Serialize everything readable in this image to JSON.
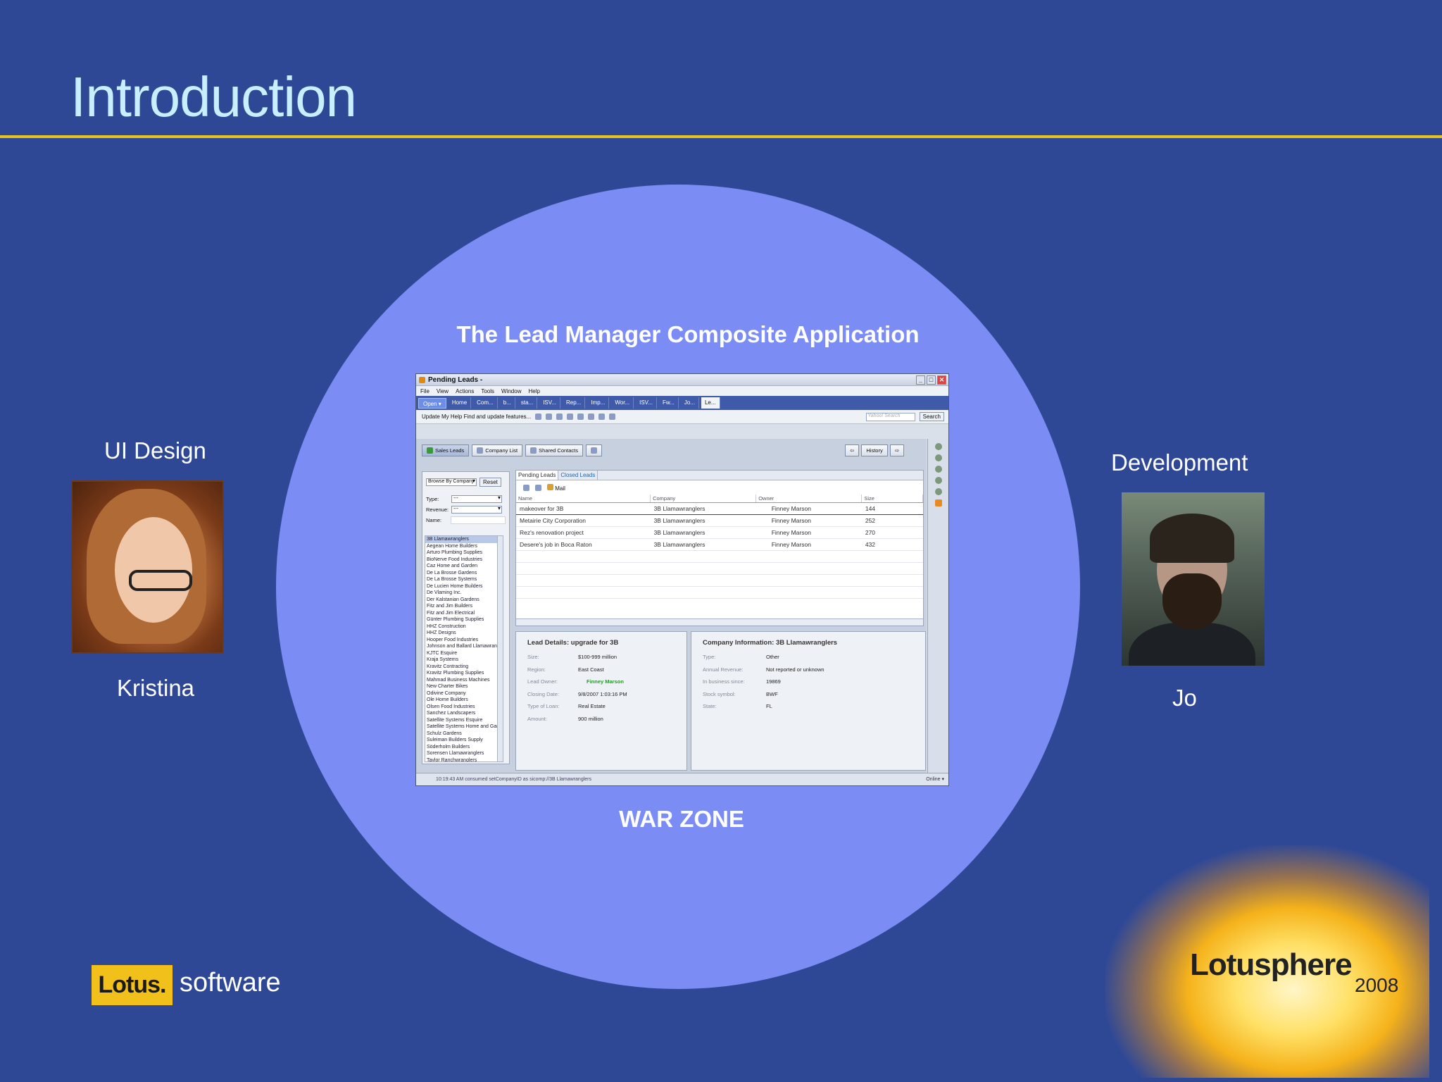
{
  "slide": {
    "title": "Introduction",
    "app_title": "The Lead Manager Composite Application",
    "war_zone": "WAR ZONE",
    "left_role": "UI Design",
    "left_name": "Kristina",
    "right_role": "Development",
    "right_name": "Jo",
    "logo_lotus": "Lotus.",
    "logo_software": "software",
    "logo_lotusphere": "Lotusphere",
    "logo_year": "2008",
    "accent_color": "#e8c51a",
    "background_color": "#2f4896",
    "circle_color": "#7b8cf5"
  },
  "window": {
    "title": "Pending Leads -",
    "menu": [
      "File",
      "View",
      "Actions",
      "Tools",
      "Window",
      "Help"
    ],
    "open_button": "Open ▾",
    "tabs": [
      "Home",
      "Com...",
      "b...",
      "sta...",
      "ISV...",
      "Rep...",
      "Imp...",
      "Wor...",
      "ISV...",
      "Fw...",
      "Jo...",
      "Le..."
    ],
    "toolbar_text": "Update My Help   Find and update features...",
    "search_placeholder": "Yahoo! Search",
    "search_button": "Search",
    "app_buttons": [
      "Sales Leads",
      "Company List",
      "Shared Contacts"
    ],
    "history_button": "History",
    "browse_select": "Browse By Company",
    "reset_button": "Reset",
    "filter_labels": {
      "type": "Type:",
      "revenue": "Revenue:",
      "name": "Name:"
    },
    "filter_values": {
      "type": "---",
      "revenue": "---"
    },
    "companies": [
      "3B Llamawranglers",
      "Aegean Home Builders",
      "Arturo Plumbing Supplies",
      "BioNerve Food Industries",
      "Caz Home and Garden",
      "De La Brosse Gardens",
      "De La Brosse Systems",
      "De Lucien Home Builders",
      "De Vlaming Inc.",
      "Der Kalstanian Gardens",
      "Fitz and Jim Builders",
      "Fitz and Jim Electrical",
      "Günter Plumbing Supplies",
      "HHZ Construction",
      "HHZ Designs",
      "Hooper Food Industries",
      "Johnson and Ballard Llamawranglers",
      "KJTC Esquire",
      "Kraja Systems",
      "Kravitz Contracting",
      "Kravitz Plumbing Supplies",
      "Mahmad Business Machines",
      "New Charter Bikes",
      "Odivine Company",
      "Ole Home Builders",
      "Olsen Food Industries",
      "Sanchez Landscapers",
      "Satellite Systems Esquire",
      "Satellite Systems Home and Garden",
      "Schulz Gardens",
      "Suleiman Builders Supply",
      "Söderholm Builders",
      "Sorensen Llamawranglers",
      "Taylor Ranchwranglers"
    ],
    "center_tabs": [
      "Pending Leads",
      "Closed Leads"
    ],
    "mail_label": "Mail",
    "columns": [
      "Name",
      "Company",
      "Owner",
      "Size"
    ],
    "rows": [
      [
        "makeover for 3B",
        "3B Llamawranglers",
        "Finney Marson",
        "144"
      ],
      [
        "Metairie City Corporation",
        "3B Llamawranglers",
        "Finney Marson",
        "252"
      ],
      [
        "Rez's renovation project",
        "3B Llamawranglers",
        "Finney Marson",
        "270"
      ],
      [
        "Desere's job in Boca Raton",
        "3B Llamawranglers",
        "Finney Marson",
        "432"
      ]
    ],
    "lead_details": {
      "heading": "Lead Details: upgrade for 3B",
      "fields": [
        [
          "Size:",
          "$100-999 million"
        ],
        [
          "Region:",
          "East Coast"
        ],
        [
          "Lead Owner:",
          "Finney Marson"
        ],
        [
          "Closing Date:",
          "9/8/2007 1:03:16 PM"
        ],
        [
          "Type of Loan:",
          "Real Estate"
        ],
        [
          "Amount:",
          "900 million"
        ]
      ]
    },
    "company_info": {
      "heading": "Company Information: 3B Llamawranglers",
      "fields": [
        [
          "Type:",
          "Other"
        ],
        [
          "Annual Revenue:",
          "Not reported or unknown"
        ],
        [
          "In business since:",
          "19869"
        ],
        [
          "Stock symbol:",
          "BWF"
        ],
        [
          "State:",
          "FL"
        ]
      ]
    },
    "status_text": "10:19:43 AM consumed setCompanyID as sicomp://3B Llamawranglers",
    "status_online": "Online ▾"
  }
}
